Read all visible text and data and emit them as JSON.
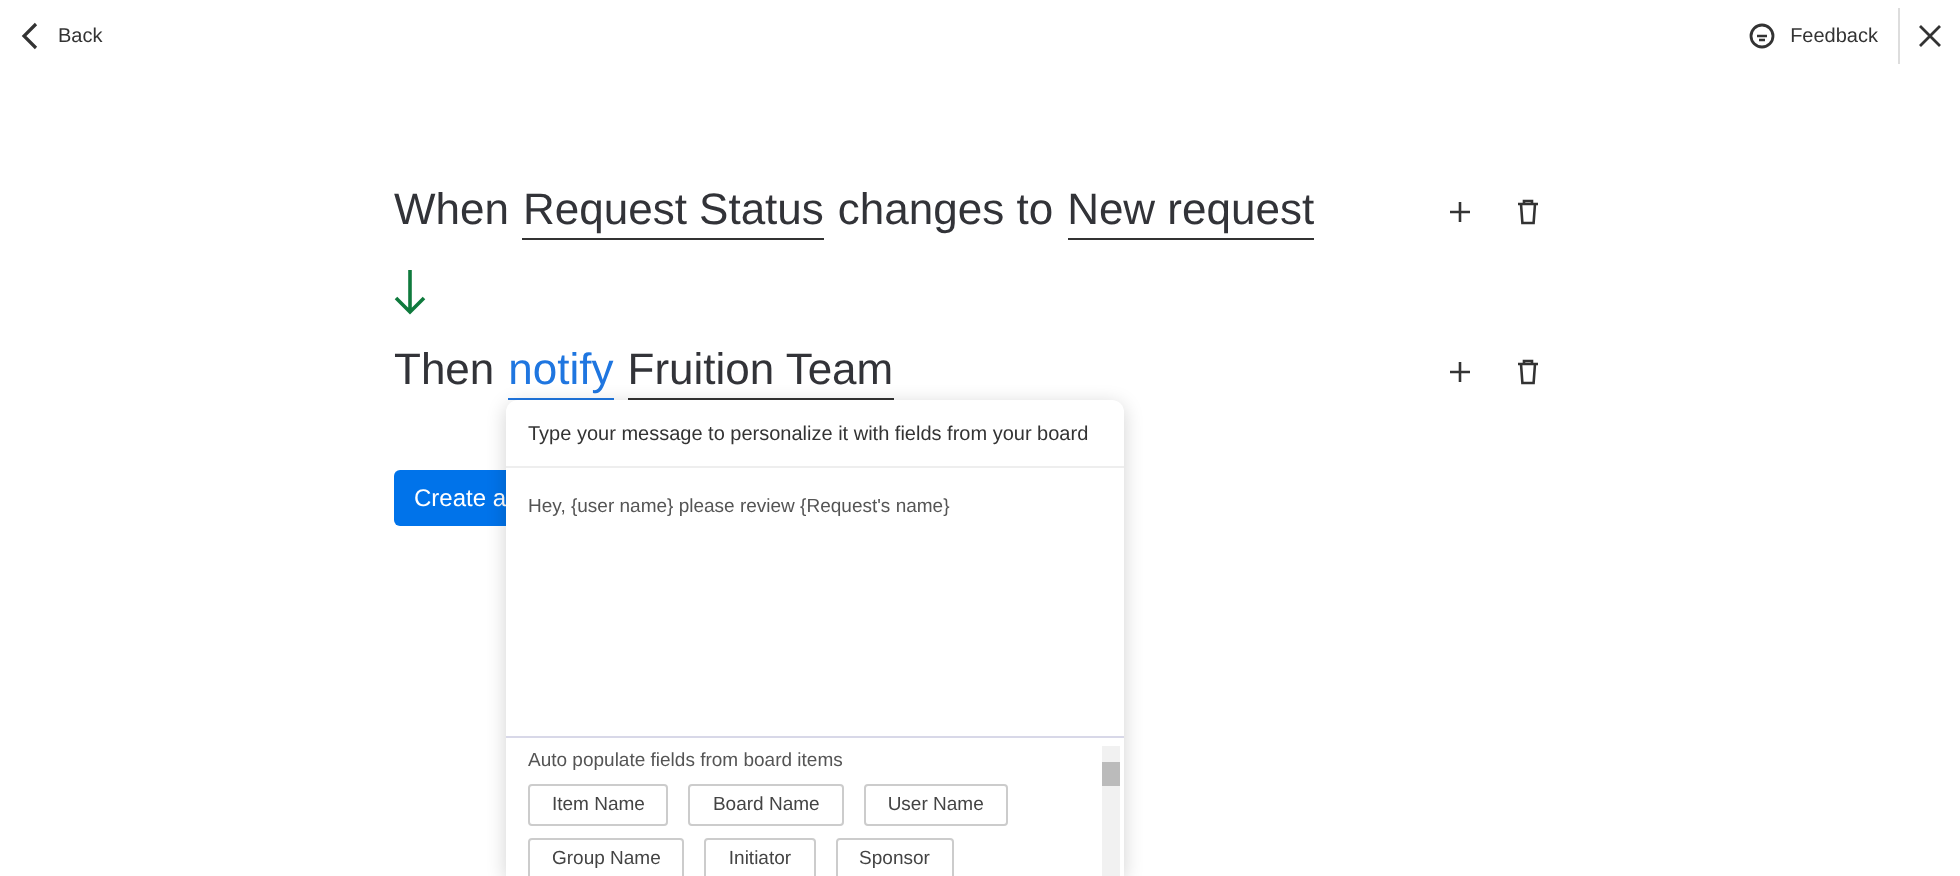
{
  "header": {
    "back_label": "Back",
    "feedback_label": "Feedback"
  },
  "rules": [
    {
      "parts": [
        {
          "text": "When",
          "kind": "plain"
        },
        {
          "text": "Request Status",
          "kind": "field"
        },
        {
          "text": "changes to",
          "kind": "plain"
        },
        {
          "text": "New request",
          "kind": "field"
        }
      ]
    },
    {
      "parts": [
        {
          "text": "Then",
          "kind": "plain"
        },
        {
          "text": "notify",
          "kind": "link"
        },
        {
          "text": "Fruition Team",
          "kind": "field"
        }
      ]
    }
  ],
  "create_button": {
    "label": "Create a"
  },
  "message_popup": {
    "hint": "Type your message to personalize it with fields from your board",
    "message": "Hey, {user name} please review {Request's name}",
    "fields_title": "Auto populate fields from board items",
    "fields": [
      "Item Name",
      "Board Name",
      "User Name",
      "Group Name",
      "Initiator",
      "Sponsor"
    ]
  }
}
